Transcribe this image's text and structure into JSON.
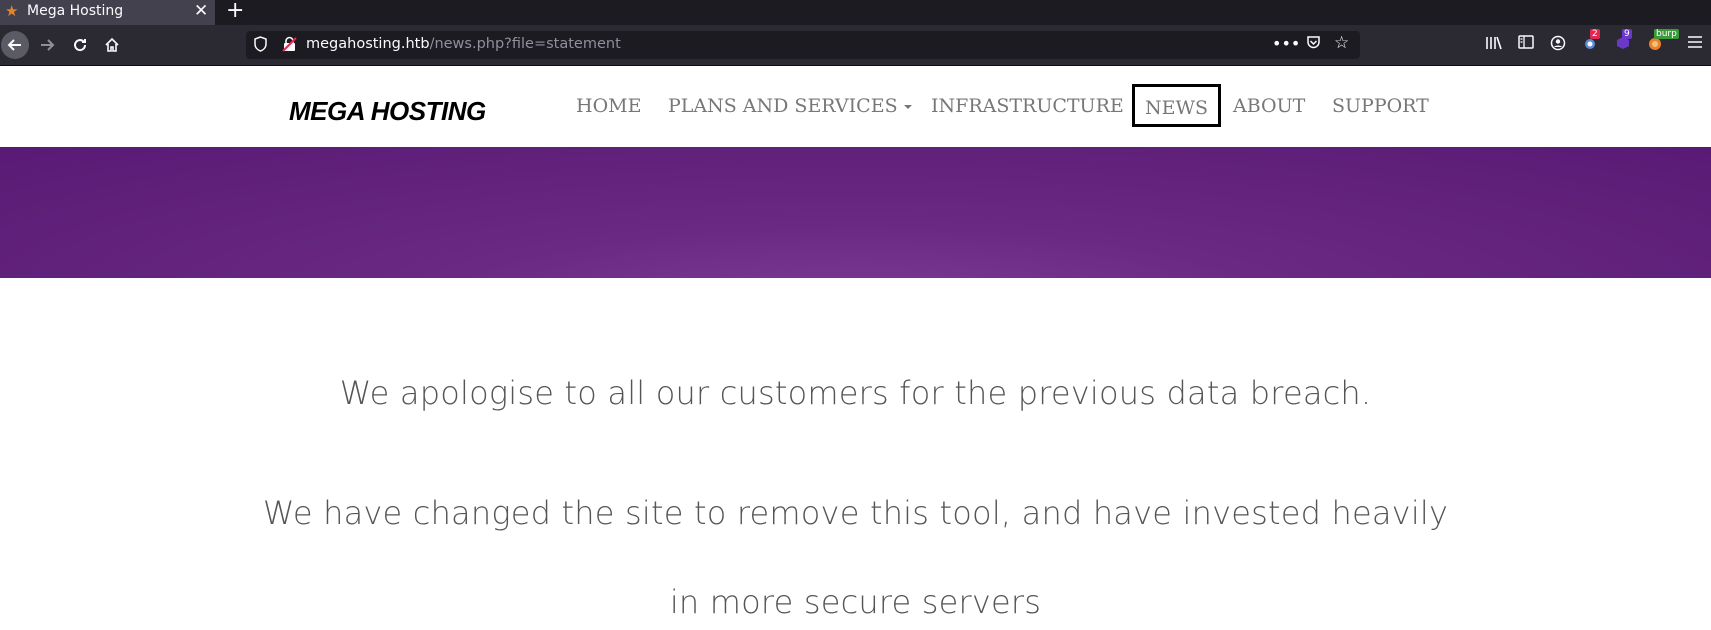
{
  "browser": {
    "tab": {
      "title": "Mega Hosting",
      "favicon": "star-icon",
      "close": "✕"
    },
    "new_tab": "+",
    "url": {
      "host": "megahosting.htb",
      "path": "/news.php?file=statement"
    },
    "toolbar_badges": {
      "extension1": "2",
      "extension2": "9",
      "burp": "burp"
    }
  },
  "site": {
    "logo": "MEGA HOSTING",
    "menu": [
      {
        "label": "HOME"
      },
      {
        "label": "PLANS AND SERVICES"
      },
      {
        "label": "INFRASTRUCTURE"
      },
      {
        "label": "NEWS"
      },
      {
        "label": "ABOUT"
      },
      {
        "label": "SUPPORT"
      }
    ],
    "hero_color": "#6a2a84"
  },
  "content": {
    "line1": "We apologise to all our customers for the previous data breach.",
    "line2": "We have changed the site to remove this tool, and have invested heavily",
    "line3": "in more secure servers"
  }
}
